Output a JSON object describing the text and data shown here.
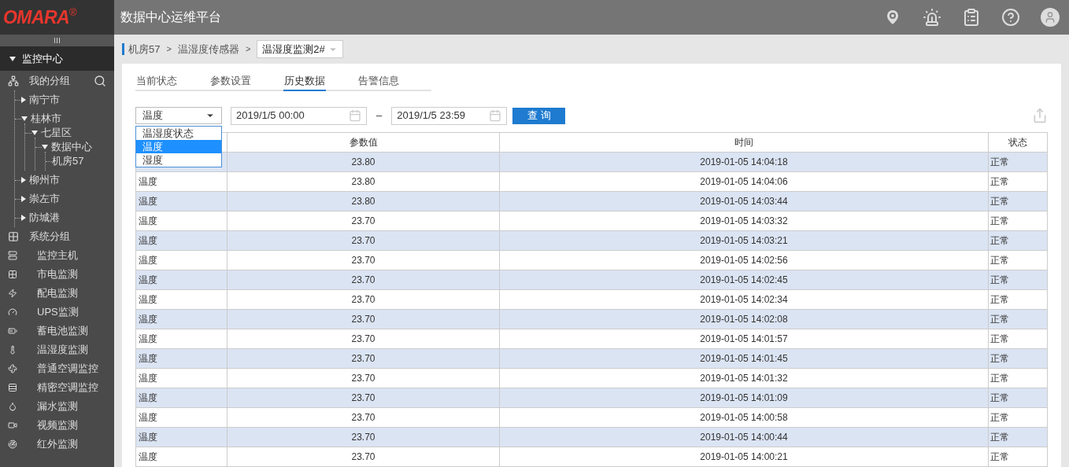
{
  "logo": {
    "brand": "OMARA",
    "mark": "®"
  },
  "app_title": "数据中心运维平台",
  "sidebar": {
    "section": {
      "label": "监控中心",
      "expanded": true
    },
    "group": {
      "label": "我的分组"
    },
    "tree": [
      {
        "label": "南宁市",
        "expanded": false
      },
      {
        "label": "桂林市",
        "expanded": true,
        "children": [
          {
            "label": "七星区",
            "expanded": true,
            "children": [
              {
                "label": "数据中心",
                "expanded": true,
                "children": [
                  {
                    "label": "机房57"
                  }
                ]
              }
            ]
          }
        ]
      },
      {
        "label": "柳州市",
        "expanded": false
      },
      {
        "label": "崇左市",
        "expanded": false
      },
      {
        "label": "防城港",
        "expanded": false
      }
    ],
    "system_group": {
      "label": "系统分组"
    },
    "items": [
      {
        "label": "监控主机",
        "kind": "host"
      },
      {
        "label": "市电监测",
        "kind": "mains"
      },
      {
        "label": "配电监测",
        "kind": "power"
      },
      {
        "label": "UPS监测",
        "kind": "ups"
      },
      {
        "label": "蓄电池监测",
        "kind": "battery"
      },
      {
        "label": "温湿度监测",
        "kind": "temp"
      },
      {
        "label": "普通空调监控",
        "kind": "ac"
      },
      {
        "label": "精密空调监控",
        "kind": "pac"
      },
      {
        "label": "漏水监测",
        "kind": "water"
      },
      {
        "label": "视频监测",
        "kind": "video"
      },
      {
        "label": "红外监测",
        "kind": "infrared"
      }
    ]
  },
  "breadcrumb": {
    "items": [
      "机房57",
      "温湿度传感器"
    ],
    "separator": ">",
    "current": "温湿度监测2#"
  },
  "tabs": [
    {
      "label": "当前状态",
      "selected": false
    },
    {
      "label": "参数设置",
      "selected": false
    },
    {
      "label": "历史数据",
      "selected": true
    },
    {
      "label": "告警信息",
      "selected": false
    }
  ],
  "filter": {
    "type_select": {
      "value": "温度",
      "expanded": true,
      "options": [
        {
          "label": "温湿度状态",
          "selected": false
        },
        {
          "label": "温度",
          "selected": true
        },
        {
          "label": "湿度",
          "selected": false
        }
      ]
    },
    "start": "2019/1/5 00:00",
    "dash": "–",
    "end": "2019/1/5 23:59",
    "query_button": "查 询"
  },
  "table": {
    "columns": [
      "参数值",
      "时间",
      "状态"
    ],
    "rows": [
      {
        "value": "23.80",
        "time": "2019-01-05 14:04:18",
        "status": "正常"
      },
      {
        "name": "温度",
        "value": "23.80",
        "time": "2019-01-05 14:04:06",
        "status": "正常"
      },
      {
        "name": "温度",
        "value": "23.80",
        "time": "2019-01-05 14:03:44",
        "status": "正常"
      },
      {
        "name": "温度",
        "value": "23.70",
        "time": "2019-01-05 14:03:32",
        "status": "正常"
      },
      {
        "name": "温度",
        "value": "23.70",
        "time": "2019-01-05 14:03:21",
        "status": "正常"
      },
      {
        "name": "温度",
        "value": "23.70",
        "time": "2019-01-05 14:02:56",
        "status": "正常"
      },
      {
        "name": "温度",
        "value": "23.70",
        "time": "2019-01-05 14:02:45",
        "status": "正常"
      },
      {
        "name": "温度",
        "value": "23.70",
        "time": "2019-01-05 14:02:34",
        "status": "正常"
      },
      {
        "name": "温度",
        "value": "23.70",
        "time": "2019-01-05 14:02:08",
        "status": "正常"
      },
      {
        "name": "温度",
        "value": "23.70",
        "time": "2019-01-05 14:01:57",
        "status": "正常"
      },
      {
        "name": "温度",
        "value": "23.70",
        "time": "2019-01-05 14:01:45",
        "status": "正常"
      },
      {
        "name": "温度",
        "value": "23.70",
        "time": "2019-01-05 14:01:32",
        "status": "正常"
      },
      {
        "name": "温度",
        "value": "23.70",
        "time": "2019-01-05 14:01:09",
        "status": "正常"
      },
      {
        "name": "温度",
        "value": "23.70",
        "time": "2019-01-05 14:00:58",
        "status": "正常"
      },
      {
        "name": "温度",
        "value": "23.70",
        "time": "2019-01-05 14:00:44",
        "status": "正常"
      },
      {
        "name": "温度",
        "value": "23.70",
        "time": "2019-01-05 14:00:21",
        "status": "正常"
      }
    ]
  }
}
